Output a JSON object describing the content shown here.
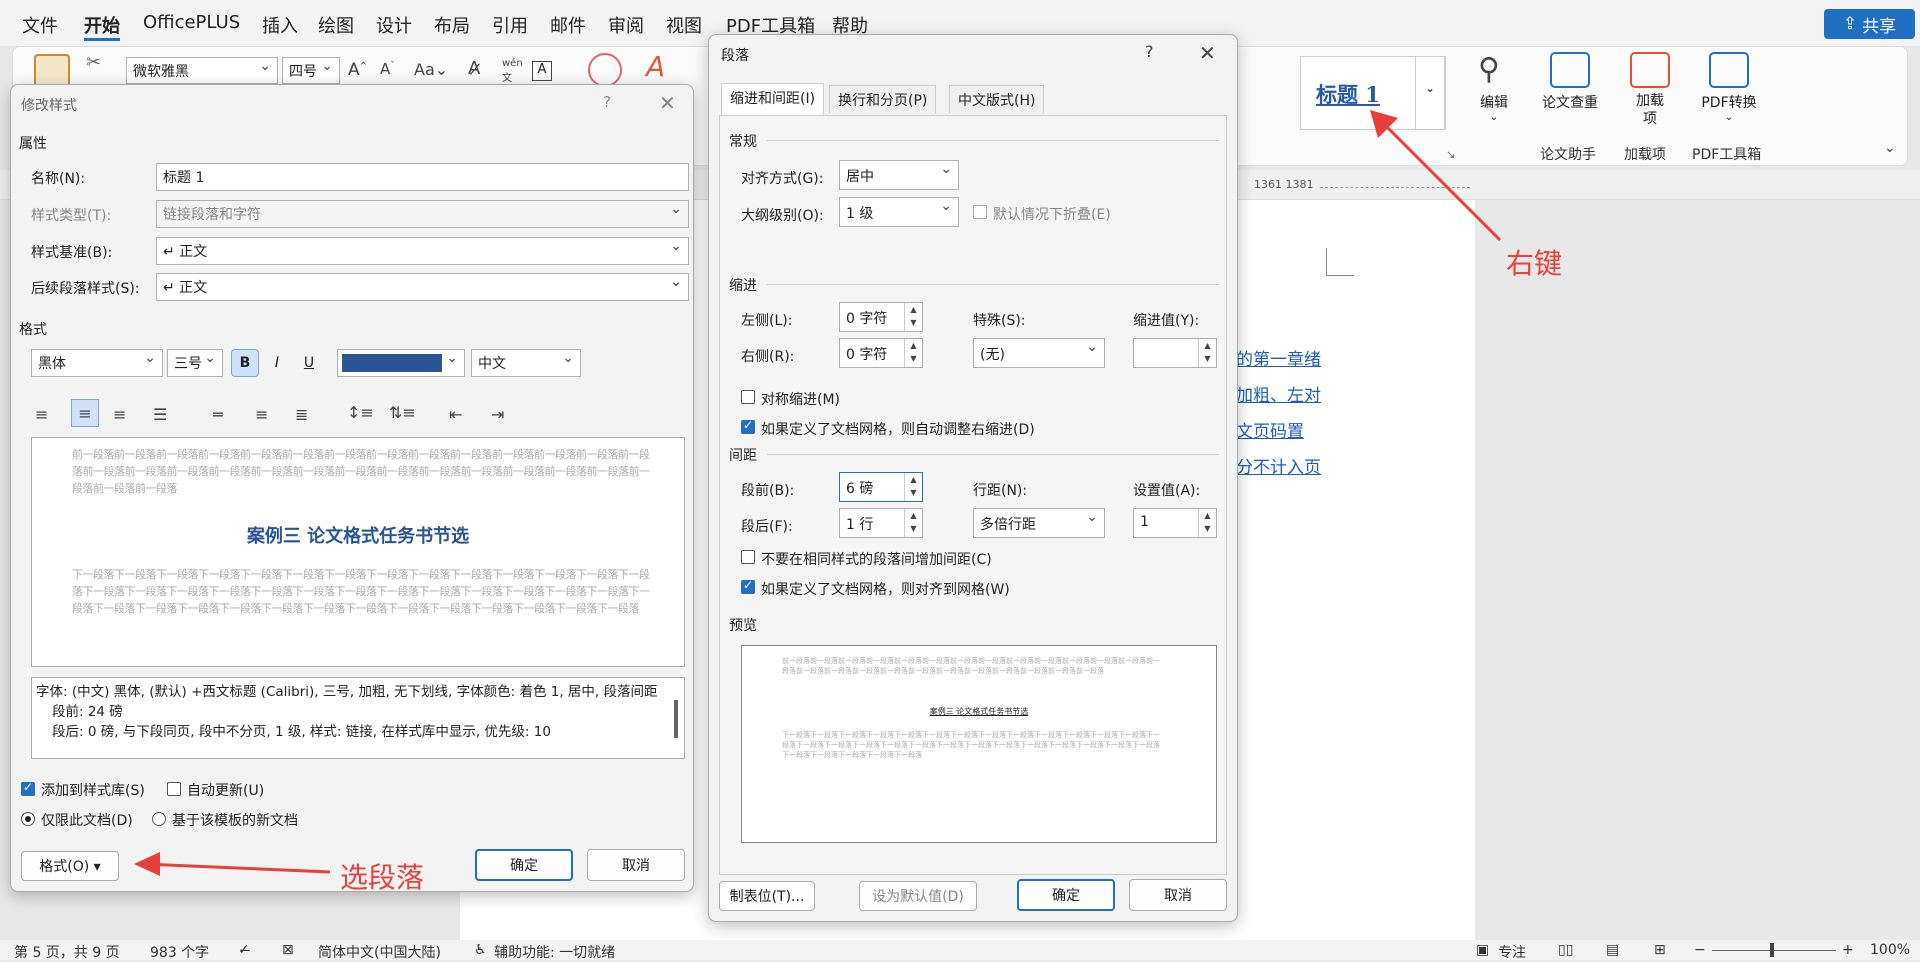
{
  "menu": [
    "文件",
    "开始",
    "OfficePLUS",
    "插入",
    "绘图",
    "设计",
    "布局",
    "引用",
    "邮件",
    "审阅",
    "视图",
    "PDF工具箱",
    "帮助"
  ],
  "share_label": "共享",
  "ribbon": {
    "font_name": "微软雅黑",
    "font_size": "四号",
    "style_heading": "标题 1",
    "edit": "编辑",
    "check": "论文查重",
    "addins": "加载项",
    "pdf": "PDF转换",
    "grp_thesis": "论文助手",
    "grp_addins": "加载项",
    "grp_pdf": "PDF工具箱",
    "ruler_nums": "1361  1381"
  },
  "doc_links": [
    "的第一章绪",
    "加粗、左对",
    "文页码置",
    "分不计入页"
  ],
  "annotations": {
    "right_click": "右键",
    "select_para": "选段落"
  },
  "modify": {
    "title": "修改样式",
    "help": "?",
    "section_props": "属性",
    "name_label": "名称(N):",
    "name_value": "标题 1",
    "type_label": "样式类型(T):",
    "type_value": "链接段落和字符",
    "base_label": "样式基准(B):",
    "base_value": "↵ 正文",
    "next_label": "后续段落样式(S):",
    "next_value": "↵ 正文",
    "section_format": "格式",
    "font": "黑体",
    "size": "三号",
    "bold": "B",
    "italic": "I",
    "underline": "U",
    "lang": "中文",
    "preview_before": "前一段落前一段落前一段落前一段落前一段落前一段落前一段落前一段落前一段落前一段落前一段落前一段落前一段落前一段落前一段落前一段落前一段落前一段落前一段落前一段落前一段落前一段落前一段落前一段落前一段落前一段落前一段落前一段落前一段落前一段落",
    "preview_title": "案例三 论文格式任务书节选",
    "preview_after": "下一段落下一段落下一段落下一段落下一段落下一段落下一段落下一段落下一段落下一段落下一段落下一段落下一段落下一段落下一段落下一段落下一段落下一段落下一段落下一段落下一段落下一段落下一段落下一段落下一段落下一段落下一段落下一段落下一段落下一段落下一段落下一段落下一段落下一段落下一段落下一段落下一段落下一段落下一段落下一段落下一段落",
    "desc1": "字体: (中文) 黑体, (默认) +西文标题 (Calibri), 三号, 加粗, 无下划线, 字体颜色: 着色 1, 居中, 段落间距",
    "desc2": "段前: 24 磅",
    "desc3": "段后: 0 磅, 与下段同页, 段中不分页, 1 级, 样式: 链接, 在样式库中显示, 优先级: 10",
    "add_gallery": "添加到样式库(S)",
    "auto_update": "自动更新(U)",
    "only_doc": "仅限此文档(D)",
    "new_docs": "基于该模板的新文档",
    "format_btn": "格式(O) ▾",
    "ok": "确定",
    "cancel": "取消",
    "font_color": "#2a5595"
  },
  "para": {
    "title": "段落",
    "help": "?",
    "tabs": [
      "缩进和间距(I)",
      "换行和分页(P)",
      "中文版式(H)"
    ],
    "general": "常规",
    "align_label": "对齐方式(G):",
    "align_value": "居中",
    "outline_label": "大纲级别(O):",
    "outline_value": "1 级",
    "collapse": "默认情况下折叠(E)",
    "indent": "缩进",
    "left_label": "左侧(L):",
    "left_value": "0 字符",
    "right_label": "右侧(R):",
    "right_value": "0 字符",
    "special_label": "特殊(S):",
    "special_value": "(无)",
    "indent_by_label": "缩进值(Y):",
    "mirror": "对称缩进(M)",
    "auto_right": "如果定义了文档网格，则自动调整右缩进(D)",
    "spacing": "间距",
    "before_label": "段前(B):",
    "before_value": "6 磅",
    "after_label": "段后(F):",
    "after_value": "1 行",
    "line_label": "行距(N):",
    "line_value": "多倍行距",
    "at_label": "设置值(A):",
    "at_value": "1",
    "no_space": "不要在相同样式的段落间增加间距(C)",
    "snap_grid": "如果定义了文档网格，则对齐到网格(W)",
    "preview": "预览",
    "prev_before": "前一段落前一段落前一段落前一段落前一段落前一段落前一段落前一段落前一段落前一段落前一段落前一段落前一段落前一段落前一段落前一段落前一段落前一段落前一段落前一段落前一段落前一段落前一段落前一段落前一段落",
    "prev_title": "案例三 论文格式任务书节选",
    "prev_after": "下一段落下一段落下一段落下一段落下一段落下一段落下一段落下一段落下一段落下一段落下一段落下一段落下一段落下一段落下一段落下一段落下一段落下一段落下一段落下一段落下一段落下一段落下一段落下一段落下一段落下一段落下一段落下一段落下一段落下一段落下一段落下一段落",
    "tabs_btn": "制表位(T)...",
    "default_btn": "设为默认值(D)",
    "ok": "确定",
    "cancel": "取消"
  },
  "status": {
    "page": "第 5 页，共 9 页",
    "words": "983 个字",
    "lang": "简体中文(中国大陆)",
    "access": "辅助功能: 一切就绪",
    "focus": "专注",
    "zoom": "100%"
  }
}
